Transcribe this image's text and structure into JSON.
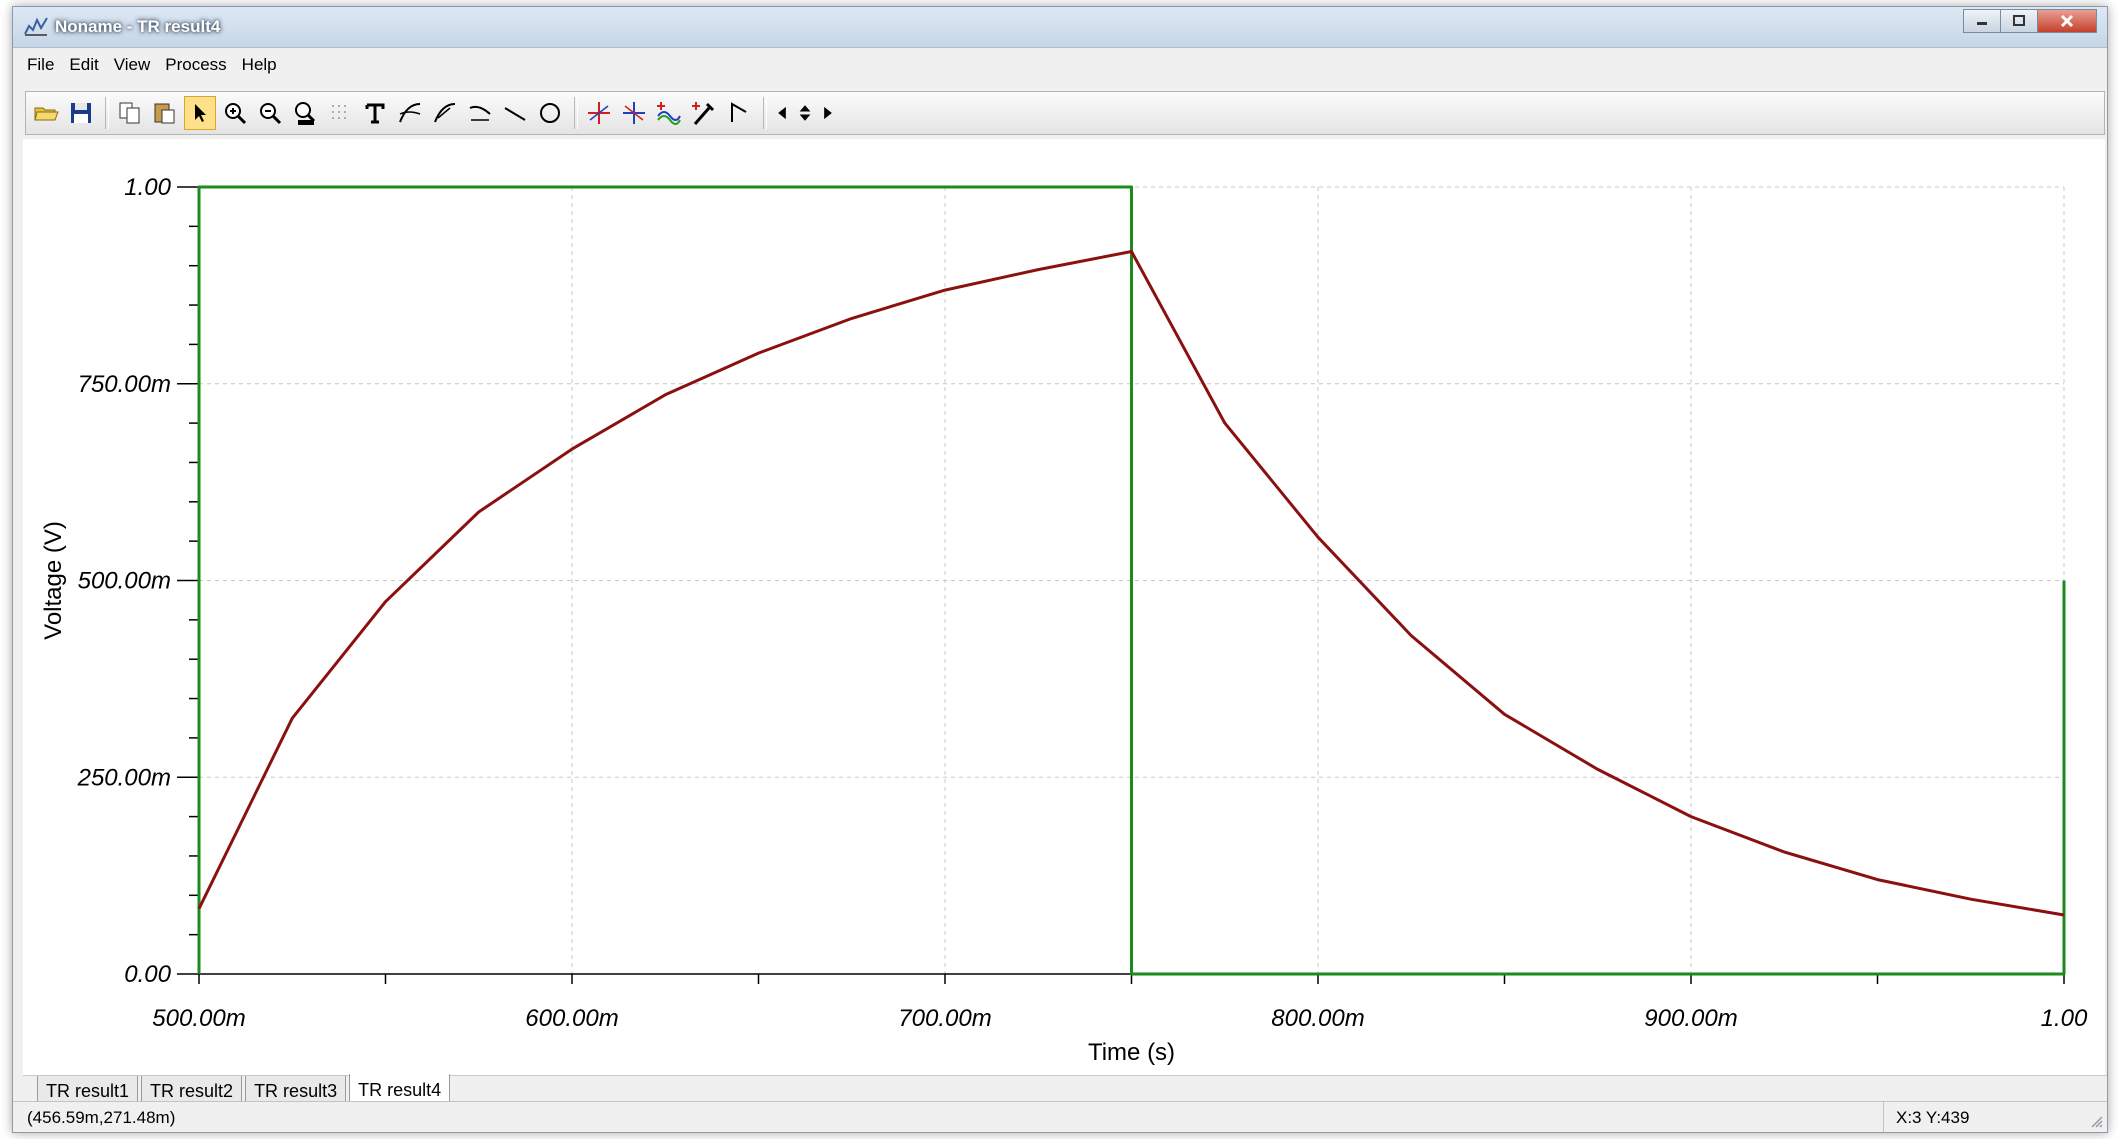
{
  "window": {
    "title": "Noname - TR result4"
  },
  "menu": [
    "File",
    "Edit",
    "View",
    "Process",
    "Help"
  ],
  "toolbar": {
    "buttons": [
      {
        "name": "open-file",
        "icon": "folder-icon"
      },
      {
        "name": "save-file",
        "icon": "floppy-icon"
      },
      {
        "name": "copy",
        "icon": "copy-icon"
      },
      {
        "name": "paste",
        "icon": "paste-icon"
      },
      {
        "name": "select",
        "icon": "arrow-pointer-icon",
        "active": true
      },
      {
        "name": "zoom-in",
        "icon": "zoom-in-icon"
      },
      {
        "name": "zoom-out",
        "icon": "zoom-out-icon"
      },
      {
        "name": "zoom-100",
        "icon": "zoom-100-icon"
      },
      {
        "name": "grid",
        "icon": "grid-icon"
      },
      {
        "name": "text",
        "icon": "text-icon"
      },
      {
        "name": "curve-1",
        "icon": "curve-icon"
      },
      {
        "name": "curve-2",
        "icon": "curve-icon"
      },
      {
        "name": "curve-3",
        "icon": "curve-icon"
      },
      {
        "name": "line",
        "icon": "line-icon"
      },
      {
        "name": "ellipse",
        "icon": "circle-icon"
      },
      {
        "name": "cursor-a",
        "icon": "cursor-a-icon"
      },
      {
        "name": "cursor-b",
        "icon": "cursor-b-icon"
      },
      {
        "name": "add-trace",
        "icon": "add-wave-icon"
      },
      {
        "name": "probe",
        "icon": "probe-icon"
      },
      {
        "name": "marker",
        "icon": "flag-icon"
      },
      {
        "name": "nav-left",
        "icon": "arrow-left-icon"
      },
      {
        "name": "nav-updown",
        "icon": "arrow-up-down-icon"
      },
      {
        "name": "nav-right",
        "icon": "arrow-right-icon"
      }
    ]
  },
  "colors": {
    "pulse": "#1e8a1e",
    "response": "#8b1010",
    "grid": "#c8c8c8",
    "axis": "#000000"
  },
  "chart_data": {
    "type": "line",
    "xlabel": "Time (s)",
    "ylabel": "Voltage (V)",
    "xlim": [
      0.5,
      1.0
    ],
    "ylim": [
      0,
      1.0
    ],
    "x_ticks": [
      0.5,
      0.6,
      0.7,
      0.8,
      0.9,
      1.0
    ],
    "x_tick_labels": [
      "500.00m",
      "600.00m",
      "700.00m",
      "800.00m",
      "900.00m",
      "1.00"
    ],
    "y_ticks": [
      0,
      0.25,
      0.5,
      0.75,
      1.0
    ],
    "y_tick_labels": [
      "0.00",
      "250.00m",
      "500.00m",
      "750.00m",
      "1.00"
    ],
    "grid": true,
    "series": [
      {
        "key": "pulse",
        "x": [
          0.5,
          0.5,
          0.75,
          0.75,
          1.0,
          1.0
        ],
        "y": [
          0.0,
          1.0,
          1.0,
          0.0,
          0.0,
          0.5
        ]
      },
      {
        "key": "response",
        "x": [
          0.5,
          0.525,
          0.55,
          0.575,
          0.6,
          0.625,
          0.65,
          0.675,
          0.7,
          0.725,
          0.75,
          0.775,
          0.8,
          0.825,
          0.85,
          0.875,
          0.9,
          0.925,
          0.95,
          0.975,
          1.0
        ],
        "y": [
          0.083,
          0.325,
          0.473,
          0.587,
          0.667,
          0.736,
          0.789,
          0.833,
          0.869,
          0.895,
          0.918,
          0.7,
          0.555,
          0.43,
          0.33,
          0.26,
          0.2,
          0.155,
          0.12,
          0.095,
          0.075
        ]
      }
    ]
  },
  "tabs": [
    {
      "label": "TR result1",
      "active": false
    },
    {
      "label": "TR result2",
      "active": false
    },
    {
      "label": "TR result3",
      "active": false
    },
    {
      "label": "TR result4",
      "active": true
    }
  ],
  "status": {
    "coords": "(456.59m,271.48m)",
    "xy": "X:3  Y:439"
  }
}
